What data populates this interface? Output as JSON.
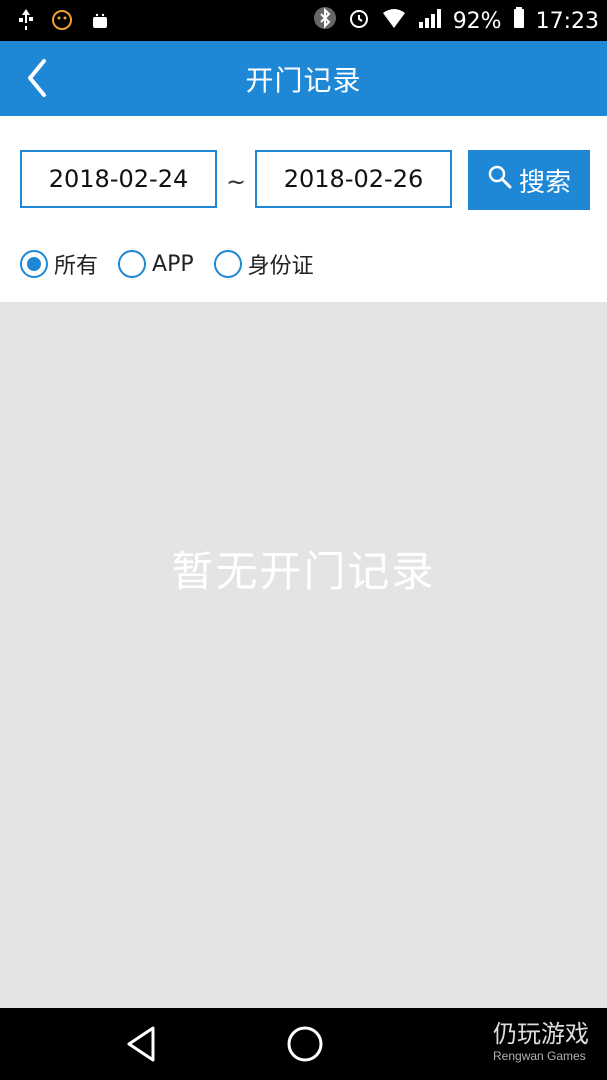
{
  "status_bar": {
    "battery": "92%",
    "time": "17:23",
    "icons": [
      "usb-icon",
      "face-icon",
      "android-icon",
      "bluetooth-icon",
      "alarm-icon",
      "wifi-icon",
      "signal-icon",
      "battery-icon"
    ]
  },
  "header": {
    "title": "开门记录"
  },
  "filters": {
    "start_date": "2018-02-24",
    "end_date": "2018-02-26",
    "tilde": "~",
    "search_label": "搜索",
    "radios": [
      {
        "label": "所有",
        "selected": true
      },
      {
        "label": "APP",
        "selected": false
      },
      {
        "label": "身份证",
        "selected": false
      }
    ]
  },
  "content": {
    "empty_text": "暂无开门记录"
  },
  "watermark": {
    "chinese": "仍玩游戏",
    "english": "Rengwan Games"
  },
  "colors": {
    "primary": "#1E88D7",
    "background": "#E4E4E4"
  }
}
